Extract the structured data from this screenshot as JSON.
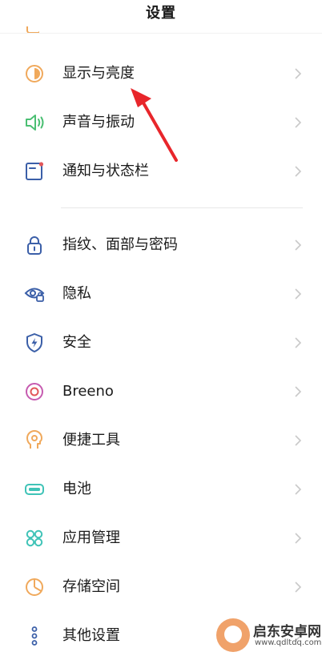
{
  "header": {
    "title": "设置"
  },
  "colors": {
    "accent_arrow": "#e8262b",
    "icon_orange": "#f0a95c",
    "icon_green": "#4bbf73",
    "icon_blue": "#3b5fa8",
    "icon_red": "#e2575a",
    "icon_teal": "#3fc3b7",
    "chevron": "#c9c9c9"
  },
  "group1": [
    {
      "label": "显示与亮度",
      "icon": "brightness-icon"
    },
    {
      "label": "声音与振动",
      "icon": "speaker-icon"
    },
    {
      "label": "通知与状态栏",
      "icon": "notification-icon"
    }
  ],
  "group2": [
    {
      "label": "指纹、面部与密码",
      "icon": "lock-icon"
    },
    {
      "label": "隐私",
      "icon": "privacy-eye-icon"
    },
    {
      "label": "安全",
      "icon": "shield-icon"
    },
    {
      "label": "Breeno",
      "icon": "breeno-icon"
    },
    {
      "label": "便捷工具",
      "icon": "tools-icon"
    },
    {
      "label": "电池",
      "icon": "battery-icon"
    },
    {
      "label": "应用管理",
      "icon": "apps-icon"
    },
    {
      "label": "存储空间",
      "icon": "storage-pie-icon"
    },
    {
      "label": "其他设置",
      "icon": "other-settings-icon"
    }
  ],
  "watermark": {
    "name": "启东安卓网",
    "url": "www.qdltdq.com"
  }
}
